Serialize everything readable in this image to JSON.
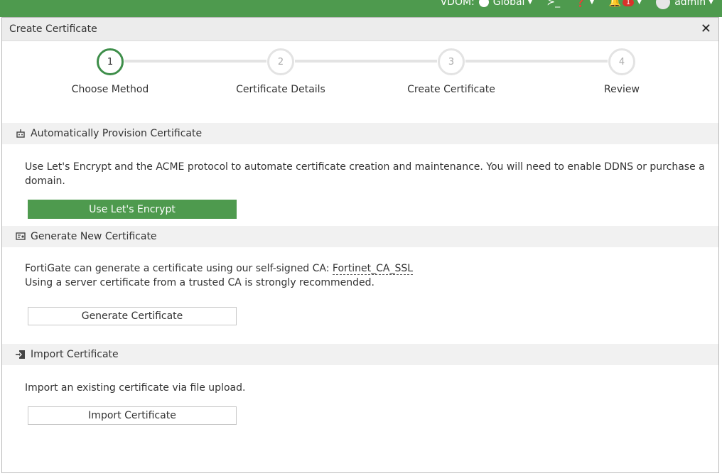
{
  "topbar": {
    "vdom_label": "VDOM:",
    "vdom_value": "Global",
    "notification_count": "1",
    "user": "admin"
  },
  "dialog": {
    "title": "Create Certificate",
    "steps": [
      {
        "number": "1",
        "label": "Choose Method"
      },
      {
        "number": "2",
        "label": "Certificate Details"
      },
      {
        "number": "3",
        "label": "Create Certificate"
      },
      {
        "number": "4",
        "label": "Review"
      }
    ],
    "active_step": 1,
    "sections": {
      "auto": {
        "title": "Automatically Provision Certificate",
        "description": "Use Let's Encrypt and the ACME protocol to automate certificate creation and maintenance. You will need to enable DDNS or purchase a domain.",
        "button": "Use Let's Encrypt"
      },
      "generate": {
        "title": "Generate New Certificate",
        "line1_prefix": "FortiGate can generate a certificate using our self-signed CA: ",
        "ca_name": "Fortinet_CA_SSL",
        "line2": "Using a server certificate from a trusted CA is strongly recommended.",
        "button": "Generate Certificate"
      },
      "import": {
        "title": "Import Certificate",
        "description": "Import an existing certificate via file upload.",
        "button": "Import Certificate"
      }
    }
  },
  "colors": {
    "brand_green": "#4e9a4e",
    "step_active": "#3e8e4a",
    "badge_red": "#d9322b"
  }
}
